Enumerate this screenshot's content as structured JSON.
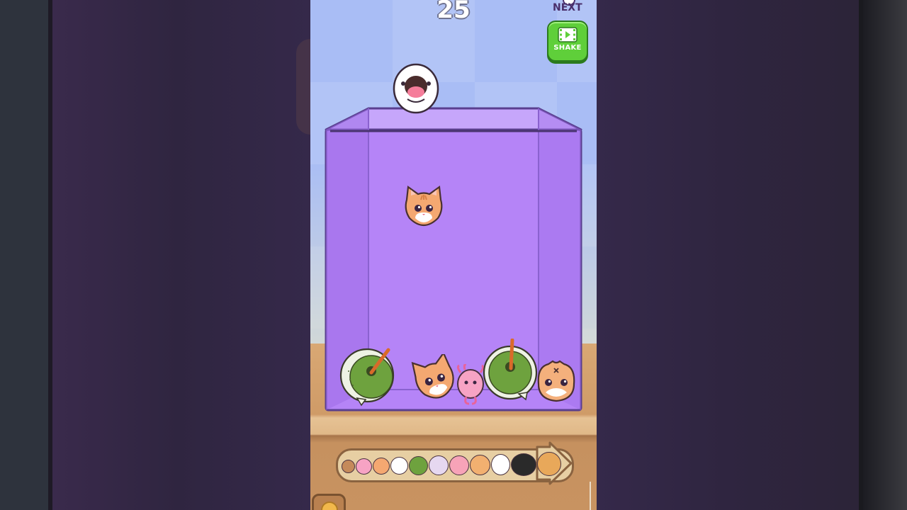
{
  "hud": {
    "score": "25",
    "next_label": "NEXT",
    "shake_label": "SHAKE"
  },
  "colors": {
    "sky": "#a9bdf5",
    "jar": "#b584f7",
    "jar_outline": "#5a3f8f",
    "floor": "#d9a874",
    "shake_button": "#5fcf3a"
  },
  "pieces": [
    {
      "kind": "egg-dog-face",
      "state": "held-in-dropper"
    },
    {
      "kind": "orange-cat-face",
      "state": "falling"
    },
    {
      "kind": "green-frog-donut",
      "state": "resting"
    },
    {
      "kind": "orange-cat-face",
      "state": "resting"
    },
    {
      "kind": "pink-axolotl",
      "state": "resting"
    },
    {
      "kind": "green-frog-donut",
      "state": "resting"
    },
    {
      "kind": "orange-hamster",
      "state": "resting"
    }
  ],
  "evolution_bar": [
    "poop-icon",
    "axolotl-icon",
    "cat-icon",
    "dog-icon",
    "frog-icon",
    "screaming-cat-icon",
    "pig-icon",
    "shiba-icon",
    "egg-icon",
    "tuxedo-cat-icon",
    "hamster-icon"
  ]
}
